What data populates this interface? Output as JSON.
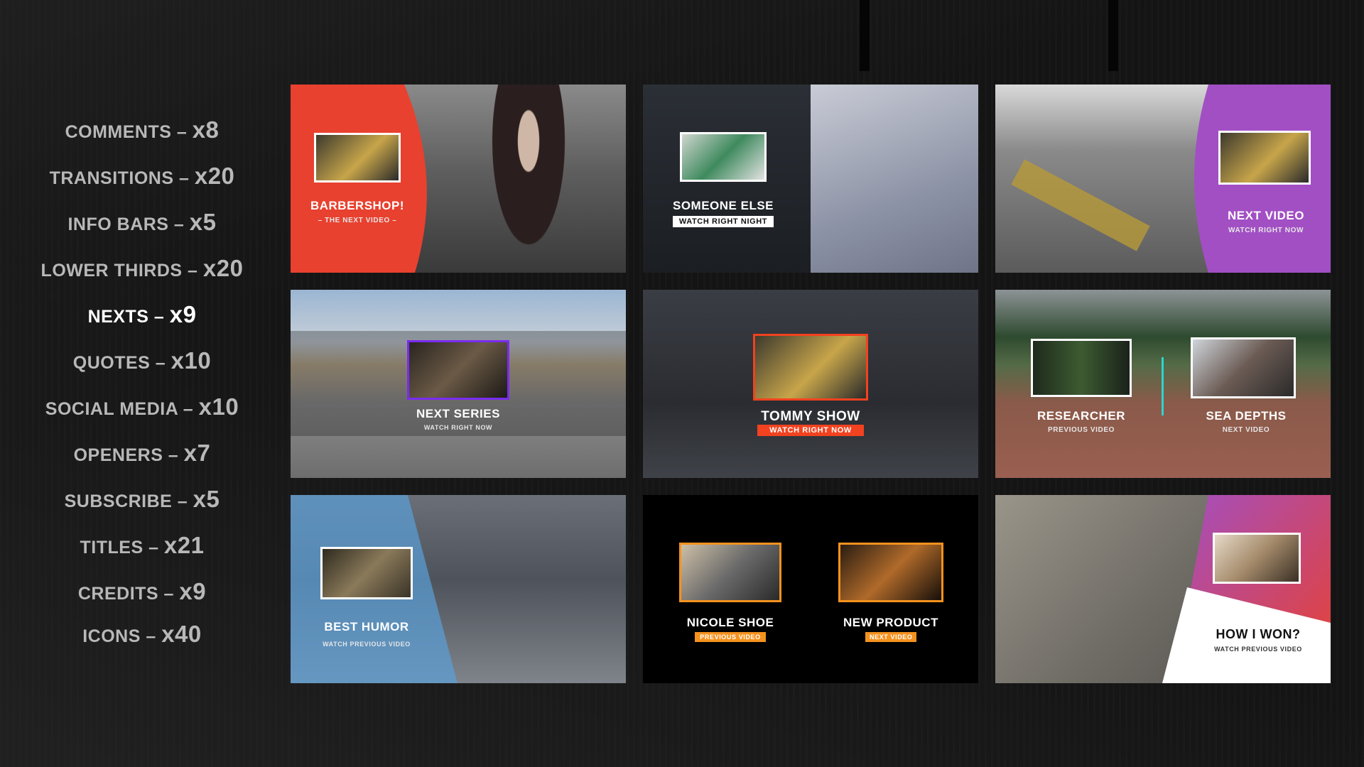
{
  "menu": {
    "items": [
      {
        "label": "COMMENTS – ",
        "count": "x8"
      },
      {
        "label": "TRANSITIONS – ",
        "count": "x20"
      },
      {
        "label": "INFO BARS – ",
        "count": "x5"
      },
      {
        "label": "LOWER THIRDS – ",
        "count": "x20"
      },
      {
        "label": "NEXTS – ",
        "count": "x9"
      },
      {
        "label": "QUOTES – ",
        "count": "x10"
      },
      {
        "label": "SOCIAL MEDIA – ",
        "count": "x10"
      },
      {
        "label": "OPENERS – ",
        "count": "x7"
      },
      {
        "label": "SUBSCRIBE – ",
        "count": "x5"
      },
      {
        "label": "TITLES – ",
        "count": "x21"
      },
      {
        "label": "CREDITS – ",
        "count": "x9"
      },
      {
        "label": "ICONS – ",
        "count": "x40"
      }
    ],
    "active_index": 4
  },
  "cards": [
    {
      "title": "BARBERSHOP!",
      "subtitle": "– THE NEXT VIDEO –",
      "accent": "#e8412f"
    },
    {
      "title": "SOMEONE ELSE",
      "subtitle": "WATCH RIGHT NIGHT",
      "accent": "#ffffff"
    },
    {
      "title": "NEXT VIDEO",
      "subtitle": "WATCH RIGHT NOW",
      "accent": "#a24fc4"
    },
    {
      "title": "NEXT SERIES",
      "subtitle": "WATCH RIGHT NOW",
      "accent": "#7a2cf0"
    },
    {
      "title": "TOMMY SHOW",
      "subtitle": "WATCH RIGHT NOW",
      "accent": "#f2421f"
    },
    {
      "title_left": "RESEARCHER",
      "subtitle_left": "PREVIOUS VIDEO",
      "title_right": "SEA DEPTHS",
      "subtitle_right": "NEXT VIDEO",
      "accent": "#2fd3d0"
    },
    {
      "title": "BEST HUMOR",
      "subtitle": "WATCH PREVIOUS VIDEO",
      "accent": "#5aa0d8"
    },
    {
      "title_left": "NICOLE SHOE",
      "subtitle_left": "PREVIOUS VIDEO",
      "title_right": "NEW PRODUCT",
      "subtitle_right": "NEXT VIDEO",
      "accent": "#f5921e"
    },
    {
      "title": "HOW I WON?",
      "subtitle": "WATCH PREVIOUS VIDEO",
      "accent": "#d9334f"
    }
  ]
}
